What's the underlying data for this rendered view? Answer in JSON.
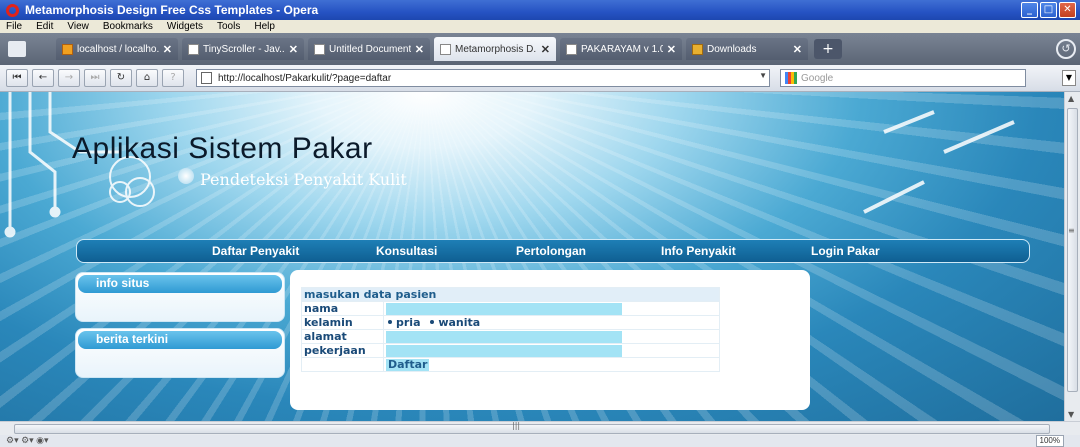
{
  "window": {
    "title": "Metamorphosis Design Free Css Templates - Opera",
    "controls": {
      "minimize": "_",
      "maximize": "□",
      "close": "✕"
    }
  },
  "menu": [
    "File",
    "Edit",
    "View",
    "Bookmarks",
    "Widgets",
    "Tools",
    "Help"
  ],
  "tabs": [
    {
      "label": "localhost / localho...",
      "close": "✕",
      "active": false,
      "icon": "phpmyadmin-icon"
    },
    {
      "label": "TinyScroller - Jav...",
      "close": "✕",
      "active": false,
      "icon": "page-icon"
    },
    {
      "label": "Untitled Document",
      "close": "✕",
      "active": false,
      "icon": "page-icon"
    },
    {
      "label": "Metamorphosis D...",
      "close": "✕",
      "active": true,
      "icon": "page-icon"
    },
    {
      "label": "PAKARAYAM v 1.0",
      "close": "✕",
      "active": false,
      "icon": "page-icon"
    },
    {
      "label": "Downloads",
      "close": "✕",
      "active": false,
      "icon": "downloads-icon"
    }
  ],
  "new_tab_label": "+",
  "nav": {
    "address": "http://localhost/Pakarkulit/?page=daftar",
    "search_placeholder": "Google"
  },
  "site": {
    "title": "Aplikasi Sistem Pakar",
    "subtitle": "Pendeteksi Penyakit Kulit",
    "menu": [
      "Daftar Penyakit",
      "Konsultasi",
      "Pertolongan",
      "Info Penyakit",
      "Login Pakar"
    ],
    "sidebar": [
      "info situs",
      "berita terkini"
    ]
  },
  "form": {
    "heading": "masukan data pasien",
    "labels": {
      "nama": "nama",
      "kelamin": "kelamin",
      "alamat": "alamat",
      "pekerjaan": "pekerjaan"
    },
    "gender_options": [
      "pria",
      "wanita"
    ],
    "submit": "Daftar"
  },
  "status": {
    "zoom": "100%"
  }
}
